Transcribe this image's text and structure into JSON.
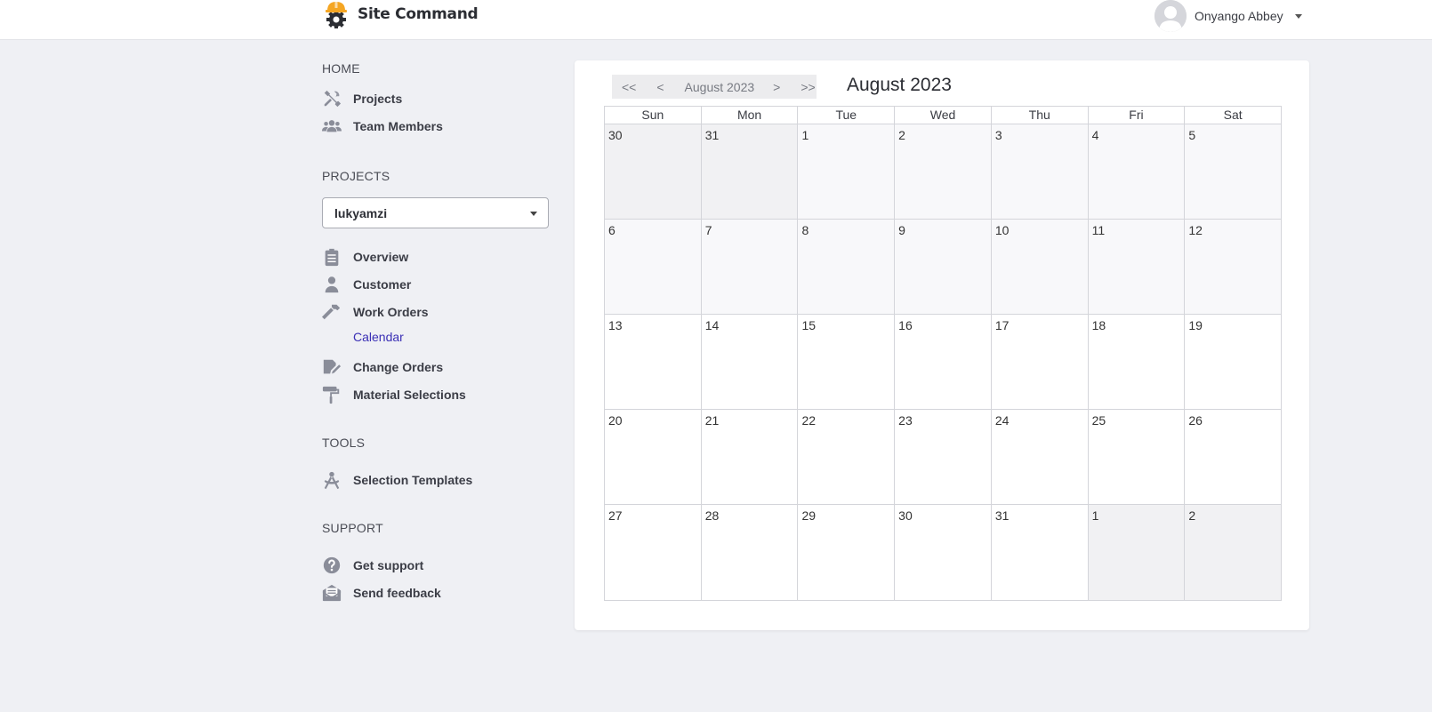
{
  "brand": {
    "name": "Site Command",
    "logo_icon": "hardhat-gear-icon",
    "accent": "#f5a623"
  },
  "user": {
    "name": "Onyango Abbey"
  },
  "sidebar": {
    "home_title": "HOME",
    "home_items": [
      {
        "label": "Projects",
        "icon": "tools-icon"
      },
      {
        "label": "Team Members",
        "icon": "users-icon"
      }
    ],
    "projects_title": "PROJECTS",
    "project_select": {
      "value": "lukyamzi"
    },
    "project_items": [
      {
        "label": "Overview",
        "icon": "clipboard-icon"
      },
      {
        "label": "Customer",
        "icon": "user-tie-icon"
      },
      {
        "label": "Work Orders",
        "icon": "hammer-icon"
      }
    ],
    "calendar_link": "Calendar",
    "project_items_2": [
      {
        "label": "Change Orders",
        "icon": "file-signature-icon"
      },
      {
        "label": "Material Selections",
        "icon": "paint-roller-icon"
      }
    ],
    "tools_title": "TOOLS",
    "tools_items": [
      {
        "label": "Selection Templates",
        "icon": "drafting-compass-icon"
      }
    ],
    "support_title": "SUPPORT",
    "support_items": [
      {
        "label": "Get support",
        "icon": "question-circle-icon"
      },
      {
        "label": "Send feedback",
        "icon": "envelope-open-text-icon"
      }
    ]
  },
  "calendar": {
    "nav": {
      "first": "<<",
      "prev": "<",
      "label": "August 2023",
      "next": ">",
      "last": ">>"
    },
    "title": "August 2023",
    "weekdays": [
      "Sun",
      "Mon",
      "Tue",
      "Wed",
      "Thu",
      "Fri",
      "Sat"
    ],
    "weeks": [
      [
        "30",
        "31",
        "1",
        "2",
        "3",
        "4",
        "5"
      ],
      [
        "6",
        "7",
        "8",
        "9",
        "10",
        "11",
        "12"
      ],
      [
        "13",
        "14",
        "15",
        "16",
        "17",
        "18",
        "19"
      ],
      [
        "20",
        "21",
        "22",
        "23",
        "24",
        "25",
        "26"
      ],
      [
        "27",
        "28",
        "29",
        "30",
        "31",
        "1",
        "2"
      ]
    ]
  },
  "colors": {
    "background": "#eff0f4",
    "link": "#3a2fb5",
    "icon": "#8a8d99",
    "other_month_cell": "#f1f1f3",
    "past_cell": "#f8f8fa"
  }
}
